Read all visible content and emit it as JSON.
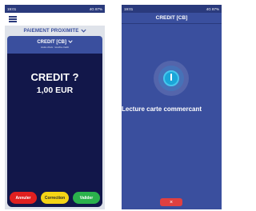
{
  "left_screen": {
    "status_left": "19:01",
    "status_right": "4G 87%",
    "section_title": "PAIEMENT PROXIMITE",
    "credit_title": "CREDIT [CB]",
    "credit_subtitle": "Autre choix : touche crédit",
    "amount_question": "CREDIT ?",
    "amount_value": "1,00 EUR",
    "buttons": {
      "annuler": "Annuler",
      "correction": "Correction",
      "valider": "Valider"
    }
  },
  "right_screen": {
    "status_left": "19:01",
    "status_right": "4G 87%",
    "header_title": "CREDIT [CB]",
    "message": "Lecture carte commercant",
    "cancel_symbol": "×"
  }
}
